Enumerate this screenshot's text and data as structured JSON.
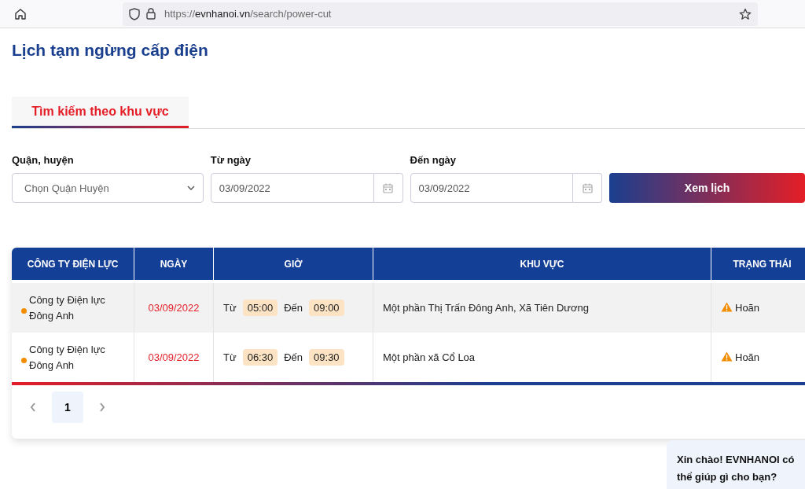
{
  "browser": {
    "url_scheme": "https://",
    "url_host": "evnhanoi.vn",
    "url_path": "/search/power-cut"
  },
  "page_title": "Lịch tạm ngừng cấp điện",
  "tabs": [
    {
      "label": "Tìm kiếm theo khu vực",
      "selected": true
    }
  ],
  "filters": {
    "district": {
      "label": "Quận, huyện",
      "placeholder": "Chọn Quận Huyện"
    },
    "from": {
      "label": "Từ ngày",
      "value": "03/09/2022"
    },
    "to": {
      "label": "Đến ngày",
      "value": "03/09/2022"
    },
    "button": "Xem lịch"
  },
  "table": {
    "columns": [
      "CÔNG TY ĐIỆN LỰC",
      "NGÀY",
      "GIỜ",
      "KHU VỰC",
      "TRẠNG THÁI"
    ],
    "rows": [
      {
        "company": "Công ty Điện lực Đông Anh",
        "color": "#f28c00",
        "date": "03/09/2022",
        "from_label": "Từ",
        "from": "05:00",
        "to_label": "Đến",
        "to": "09:00",
        "area": "Một phần Thị Trấn Đông Anh, Xã Tiên Dương",
        "status": "Hoãn",
        "kind": "warning"
      },
      {
        "company": "Công ty Điện lực Đông Anh",
        "color": "#f28c00",
        "date": "03/09/2022",
        "from_label": "Từ",
        "from": "06:30",
        "to_label": "Đến",
        "to": "09:30",
        "area": "Một phần xã Cổ Loa",
        "status": "Hoãn",
        "kind": "warning"
      }
    ]
  },
  "pagination": {
    "pages": [
      {
        "label": "1",
        "selected": true
      }
    ]
  },
  "chat": {
    "message": "Xin chào! EVNHANOI có thể giúp gì cho bạn?"
  }
}
